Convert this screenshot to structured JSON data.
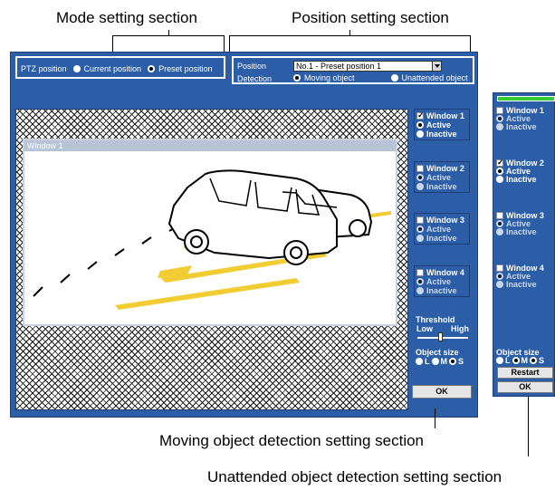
{
  "callouts": {
    "mode": "Mode setting section",
    "position": "Position setting section",
    "moving": "Moving object detection setting section",
    "unattended": "Unattended object detection setting section"
  },
  "mode": {
    "label": "PTZ position",
    "option_current": "Current position",
    "option_preset": "Preset position",
    "selected": "Preset position"
  },
  "position_box": {
    "position_label": "Position",
    "position_value": "No.1 - Preset position 1",
    "detection_label": "Detection",
    "option_moving": "Moving object",
    "option_unattended": "Unattended object",
    "selected": "Moving object"
  },
  "window_title": "Window 1",
  "windows": [
    {
      "label": "Window 1",
      "checked": true,
      "active": "Active",
      "inactive": "Inactive"
    },
    {
      "label": "Window 2",
      "checked": false,
      "active": "Active",
      "inactive": "Inactive"
    },
    {
      "label": "Window 3",
      "checked": false,
      "active": "Active",
      "inactive": "Inactive"
    },
    {
      "label": "Window 4",
      "checked": false,
      "active": "Active",
      "inactive": "Inactive"
    }
  ],
  "threshold": {
    "label": "Threshold",
    "low": "Low",
    "high": "High",
    "level": 0.5
  },
  "object_size": {
    "label": "Object size",
    "l": "L",
    "m": "M",
    "s": "S",
    "selected": "S"
  },
  "ok_label": "OK",
  "second_panel": {
    "windows": [
      {
        "label": "Window 1",
        "checked": false,
        "active": "Active",
        "inactive": "Inactive"
      },
      {
        "label": "Window 2",
        "checked": true,
        "active": "Active",
        "inactive": "Inactive"
      },
      {
        "label": "Window 3",
        "checked": false,
        "active": "Active",
        "inactive": "Inactive"
      },
      {
        "label": "Window 4",
        "checked": false,
        "active": "Active",
        "inactive": "Inactive"
      }
    ],
    "object_size_label": "Object size",
    "l": "L",
    "m": "M",
    "s": "S",
    "restart_label": "Restart",
    "ok_label": "OK",
    "progress_color": "#33cc33"
  },
  "colors": {
    "panel": "#2b5ea6",
    "highlight": "#ffd21a"
  }
}
